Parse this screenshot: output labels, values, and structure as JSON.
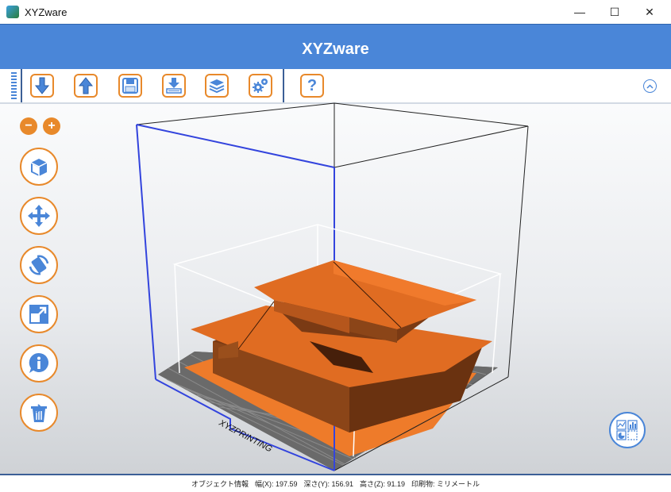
{
  "window": {
    "title": "XYZware",
    "minimize": "—",
    "maximize": "☐",
    "close": "✕"
  },
  "header": {
    "brand": "XYZware"
  },
  "toolbar": {
    "buttons": [
      {
        "icon": "import-arrow-down-icon"
      },
      {
        "icon": "export-arrow-up-icon"
      },
      {
        "icon": "save-disk-icon"
      },
      {
        "icon": "print-icon"
      },
      {
        "icon": "layers-icon"
      },
      {
        "icon": "settings-gears-icon"
      },
      {
        "icon": "help-icon",
        "label": "?"
      }
    ],
    "collapse_icon": "chevron-up-icon"
  },
  "viewport": {
    "zoom_out": "−",
    "zoom_in": "+",
    "bed_label": "XYZPRINTING",
    "tools": [
      "view-cube-icon",
      "move-icon",
      "rotate-icon",
      "scale-icon",
      "info-icon",
      "delete-icon"
    ]
  },
  "status": {
    "object_info": "オブジェクト情報",
    "width": "幅(X): 197.59",
    "depth": "深さ(Y): 156.91",
    "height": "高さ(Z): 91.19",
    "print": "印刷物: ミリメートル"
  },
  "colors": {
    "accent": "#4a86d8",
    "orange": "#e8892b",
    "model": "#e06c22"
  }
}
